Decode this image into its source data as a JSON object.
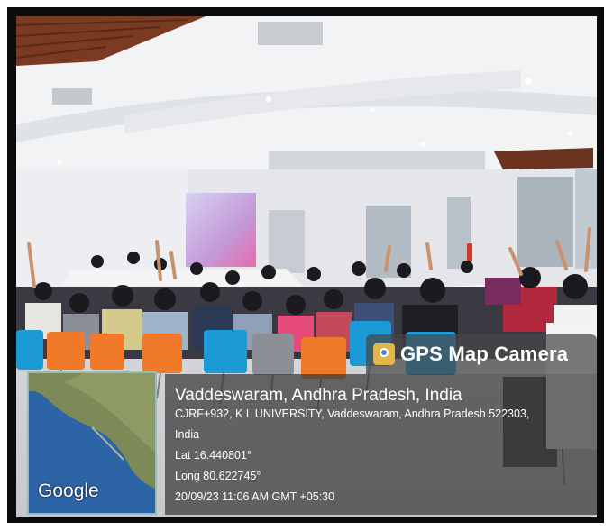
{
  "overlay": {
    "badge_title": "GPS Map Camera",
    "badge_icon": "map-pin-icon",
    "place": "Vaddeswaram, Andhra Pradesh, India",
    "address_line1": "CJRF+932, K L UNIVERSITY, Vaddeswaram, Andhra Pradesh 522303,",
    "address_line2": "India",
    "latitude": "Lat 16.440801°",
    "longitude": "Long 80.622745°",
    "timestamp": "20/09/23 11:06 AM GMT +05:30"
  },
  "map": {
    "logo_text": "Google"
  },
  "colors": {
    "chair_blue": "#1c9ad6",
    "chair_orange": "#f07a2a",
    "overlay_bg": "#3a3a3a"
  }
}
